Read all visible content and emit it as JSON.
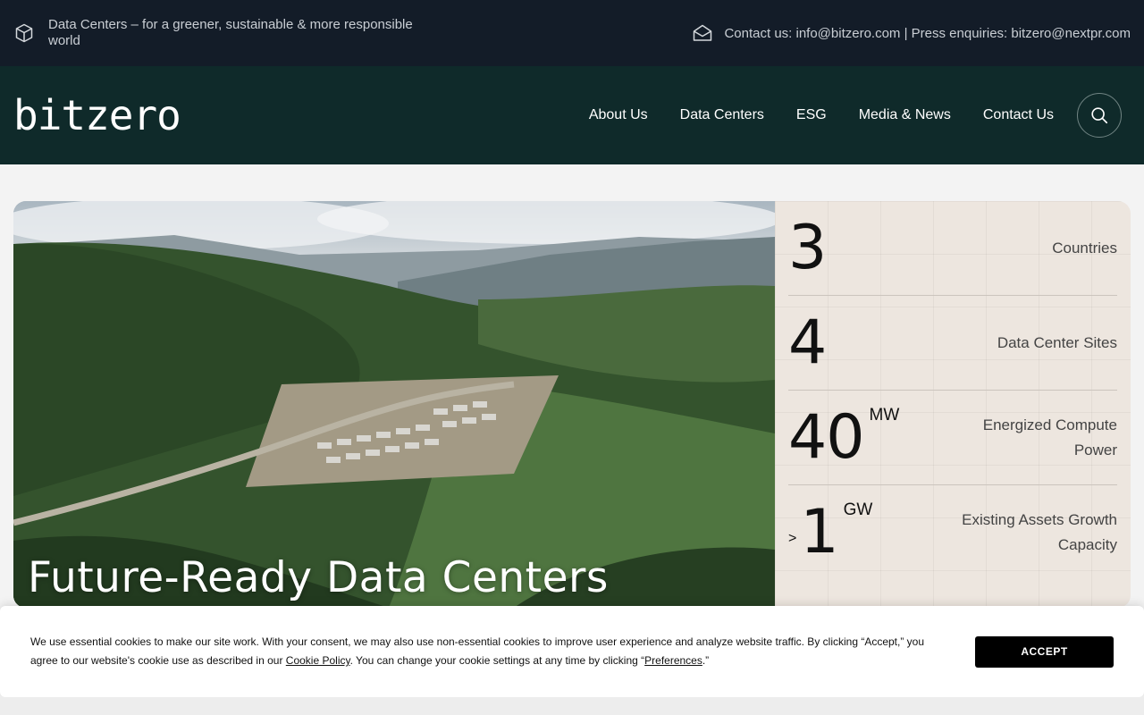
{
  "topbar": {
    "tagline": "Data Centers – for a greener, sustainable & more responsible world",
    "contact_text": "Contact us: info@bitzero.com | Press enquiries: bitzero@nextpr.com",
    "box_icon": "cube-icon",
    "mail_icon": "envelope-icon"
  },
  "header": {
    "logo": "bitzero",
    "nav": [
      "About Us",
      "Data Centers",
      "ESG",
      "Media & News",
      "Contact Us"
    ],
    "search_icon": "search-icon"
  },
  "hero": {
    "title": "Future-Ready Data Centers",
    "stats": [
      {
        "prefix": "",
        "value": "3",
        "unit": "",
        "label": "Countries"
      },
      {
        "prefix": "",
        "value": "4",
        "unit": "",
        "label": "Data Center Sites"
      },
      {
        "prefix": "",
        "value": "40",
        "unit": "MW",
        "label": "Energized Compute Power"
      },
      {
        "prefix": ">",
        "value": "1",
        "unit": "GW",
        "label": "Existing Assets Growth Capacity"
      }
    ]
  },
  "cookie": {
    "text_1": "We use essential cookies to make our site work. With your consent, we may also use non-essential cookies to improve user experience and analyze website traffic. By clicking “Accept,” you agree to our website's cookie use as described in our ",
    "policy_link": "Cookie Policy",
    "text_2": ". You can change your cookie settings at any time by clicking “",
    "preferences_link": "Preferences",
    "text_3": ".”",
    "accept_label": "ACCEPT"
  },
  "colors": {
    "topbar_bg": "#131c28",
    "header_bg": "#0f2a2a",
    "stats_bg": "#ede6df"
  }
}
